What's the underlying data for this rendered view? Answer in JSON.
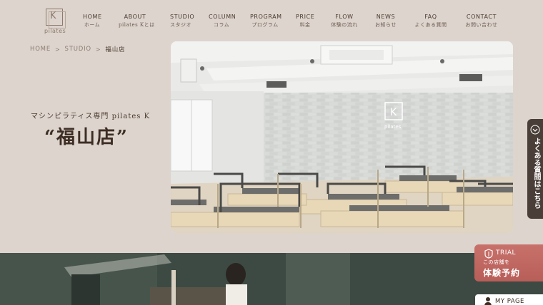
{
  "logo": {
    "mark": "K",
    "text": "pilates"
  },
  "nav": [
    {
      "en": "HOME",
      "jp": "ホーム"
    },
    {
      "en": "ABOUT",
      "jp": "pilates Kとは"
    },
    {
      "en": "STUDIO",
      "jp": "スタジオ"
    },
    {
      "en": "COLUMN",
      "jp": "コラム"
    },
    {
      "en": "PROGRAM",
      "jp": "プログラム"
    },
    {
      "en": "PRICE",
      "jp": "料金"
    },
    {
      "en": "FLOW",
      "jp": "体験の流れ"
    },
    {
      "en": "NEWS",
      "jp": "お知らせ"
    },
    {
      "en": "FAQ",
      "jp": "よくある質問"
    },
    {
      "en": "CONTACT",
      "jp": "お問い合わせ"
    }
  ],
  "breadcrumb": {
    "home": "HOME",
    "studio": "STUDIO",
    "current": "福山店",
    "separator": ">"
  },
  "hero": {
    "subtitle": "マシンピラティス専門 pilates K",
    "title": "“福山店”"
  },
  "side_tab": {
    "label": "よくある質問はこちら"
  },
  "trial": {
    "en": "TRIAL",
    "sub": "この店舗を",
    "main": "体験予約",
    "icon": "shield-icon"
  },
  "mypage": {
    "label": "MY PAGE",
    "icon": "person-icon"
  },
  "colors": {
    "background": "#ddd4cd",
    "band": "#3f4c45",
    "trial": "#c0675f",
    "side_tab": "#4a3f38"
  }
}
